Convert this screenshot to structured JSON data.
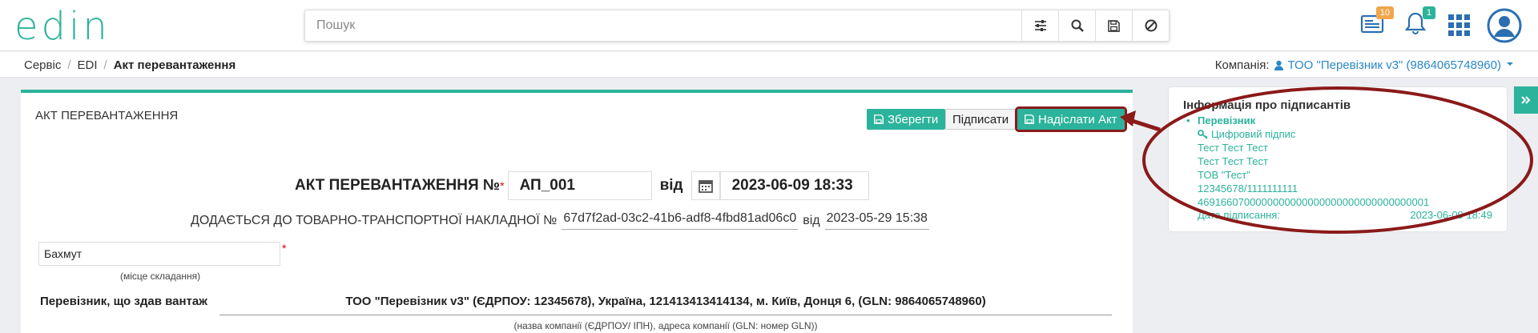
{
  "header": {
    "logo": "edin",
    "search_placeholder": "Пошук",
    "icons": [
      "settings-sliders-icon",
      "search-icon",
      "save-icon",
      "block-icon"
    ],
    "notifications": {
      "docs_count": "10",
      "bell_count": "1"
    }
  },
  "breadcrumb": {
    "items": [
      "Сервіс",
      "EDI",
      "Акт перевантаження"
    ],
    "company_label": "Компанія:",
    "company_value": "ТОО \"Перевізник v3\" (9864065748960)"
  },
  "panel": {
    "title": "АКТ ПЕРЕВАНТАЖЕННЯ",
    "buttons": {
      "save": "Зберегти",
      "sign": "Підписати",
      "send": "Надіслати Акт"
    },
    "act_title": "АКТ ПЕРЕВАНТАЖЕННЯ №",
    "act_number": "АП_001",
    "from_label": "від",
    "act_date": "2023-06-09 18:33",
    "waybill_label": "ДОДАЄТЬСЯ ДО ТОВАРНО-ТРАНСПОРТНОЇ НАКЛАДНОЇ №",
    "waybill_number": "67d7f2ad-03c2-41b6-adf8-4fbd81ad06c0",
    "waybill_from": "від",
    "waybill_date": "2023-05-29 15:38",
    "city_value": "Бахмут",
    "city_hint": "(місце складання)",
    "carrier_label": "Перевізник, що здав вантаж",
    "carrier_value": "ТОО \"Перевізник v3\" (ЄДРПОУ: 12345678), Україна, 121413413414134, м. Київ, Донця 6, (GLN: 9864065748960)",
    "carrier_hint": "(назва компанії (ЄДРПОУ/ ІПН), адреса компанії (GLN: номер GLN))"
  },
  "signers": {
    "title": "Інформація про підписантів",
    "role": "Перевізник",
    "sig_type": "Цифровий підпис",
    "lines": [
      "Тест Тест Тест",
      "Тест Тест Тест",
      "ТОВ \"Тест\"",
      "12345678/1111111111",
      "4691660700000000000000000000000000000001"
    ],
    "date_label": "Дата підписання:",
    "date_value": "2023-06-09 18:49"
  },
  "colors": {
    "accent": "#2bb39b",
    "annotation": "#8b1a1a",
    "link": "#2b88c7"
  }
}
